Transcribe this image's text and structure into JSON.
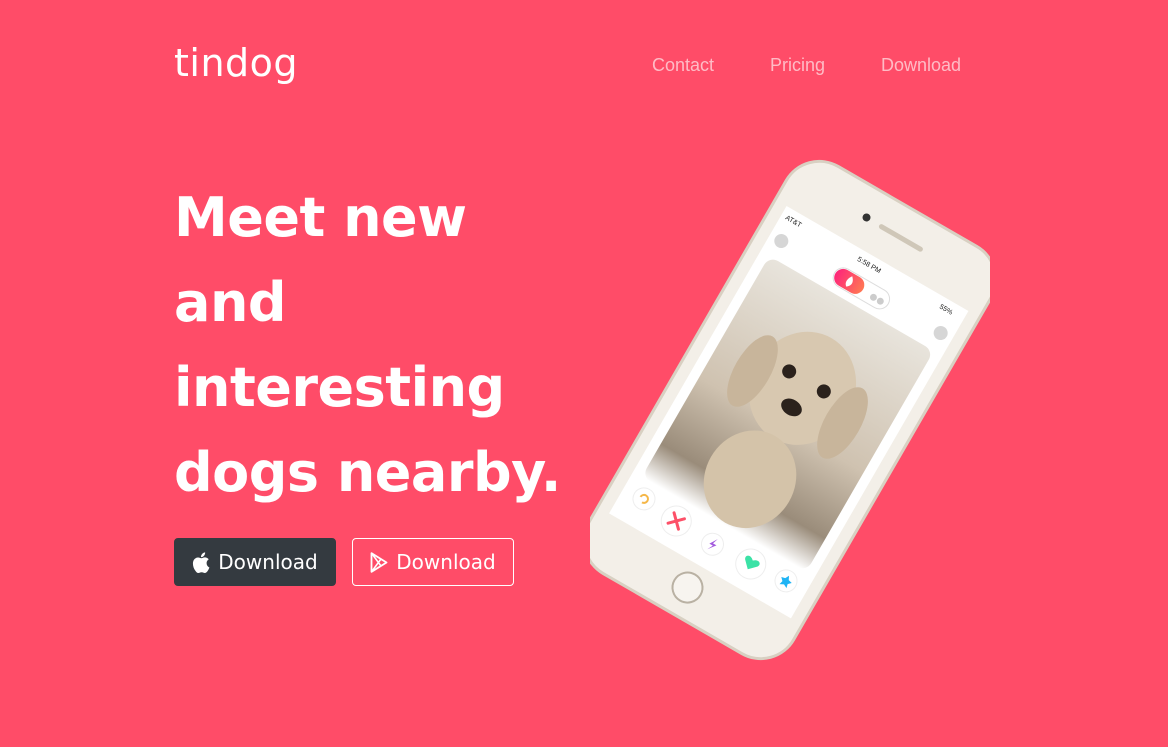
{
  "brand": {
    "name": "tindog"
  },
  "nav": {
    "items": [
      {
        "label": "Contact"
      },
      {
        "label": "Pricing"
      },
      {
        "label": "Download"
      }
    ]
  },
  "hero": {
    "headline_lines": [
      "Meet new",
      "and",
      "interesting",
      "dogs nearby."
    ],
    "buttons": [
      {
        "label": "Download",
        "icon": "apple-icon"
      },
      {
        "label": "Download",
        "icon": "google-play-icon"
      }
    ]
  },
  "phone": {
    "carrier": "AT&T",
    "time": "5:58 PM",
    "battery": "55%"
  },
  "colors": {
    "background": "#ff4c68",
    "dark_button": "#343a40"
  }
}
